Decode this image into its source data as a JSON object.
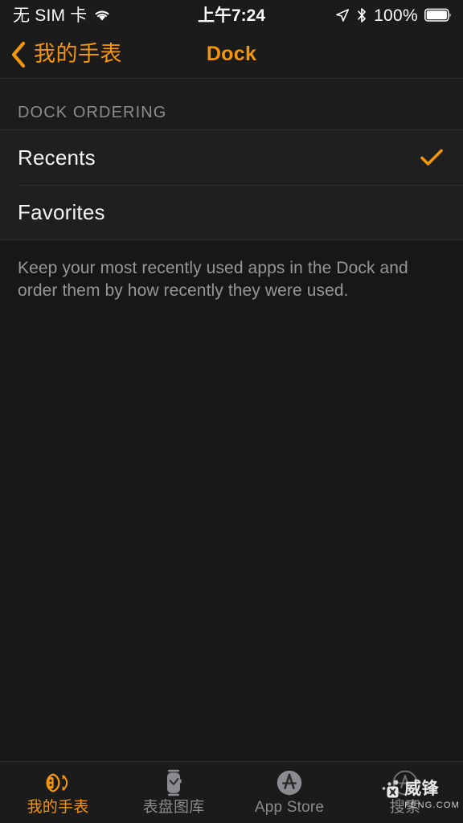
{
  "status_bar": {
    "carrier": "无 SIM 卡",
    "wifi_icon": "wifi-icon",
    "time": "上午7:24",
    "location_icon": "location-arrow-icon",
    "bluetooth_icon": "bluetooth-icon",
    "battery_percent": "100%",
    "battery_icon": "battery-full-icon"
  },
  "nav_bar": {
    "back_icon": "chevron-left-icon",
    "back_label": "我的手表",
    "title": "Dock"
  },
  "content": {
    "group_header": "DOCK ORDERING",
    "rows": [
      {
        "label": "Recents",
        "checked": true,
        "check_icon": "checkmark-icon"
      },
      {
        "label": "Favorites",
        "checked": false,
        "check_icon": "checkmark-icon"
      }
    ],
    "footer": "Keep your most recently used apps in the Dock and order them by how recently they were used."
  },
  "tab_bar": {
    "items": [
      {
        "label": "我的手表",
        "icon": "watch-outline-icon",
        "active": true
      },
      {
        "label": "表盘图库",
        "icon": "watch-face-icon",
        "active": false
      },
      {
        "label": "App Store",
        "icon": "app-store-icon",
        "active": false
      },
      {
        "label": "搜索",
        "icon": "app-store-search-icon",
        "active": false
      }
    ]
  },
  "watermark": {
    "title": "威锋",
    "subtitle": "FENG.COM"
  },
  "colors": {
    "accent": "#f2960c",
    "background": "#171717",
    "cell_background": "#1f1f1f",
    "bar_background": "#1b1b1b",
    "primary_text": "#f4f4f4",
    "secondary_text": "#8c8c91"
  }
}
